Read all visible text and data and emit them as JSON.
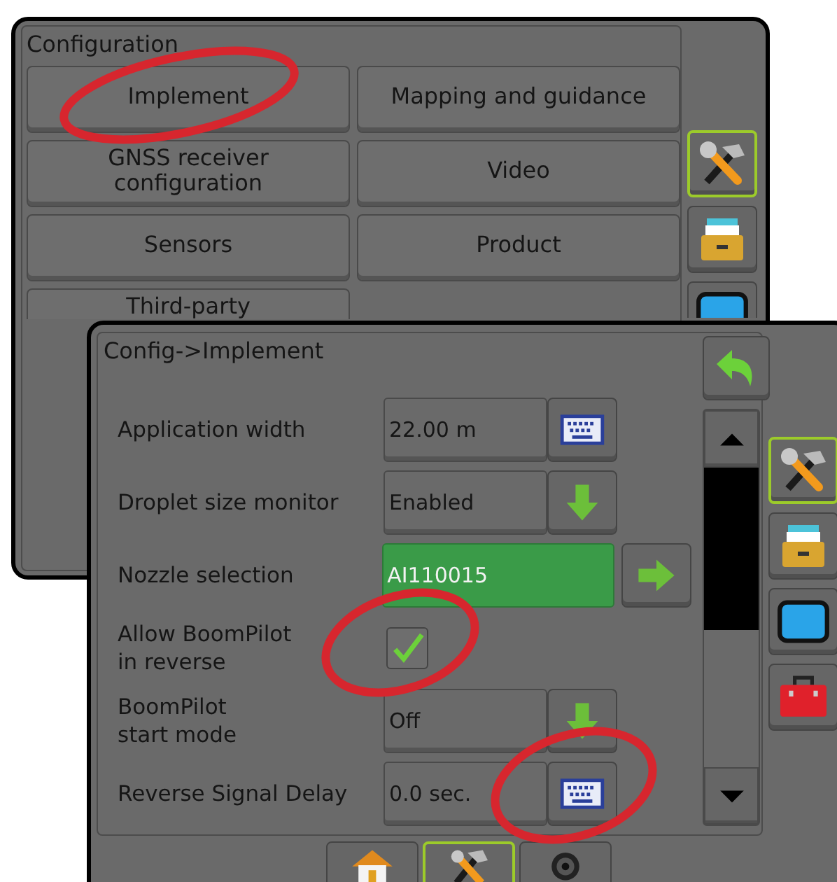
{
  "back_window": {
    "title": "Configuration",
    "buttons": [
      {
        "label": "Implement"
      },
      {
        "label": "Mapping and guidance"
      },
      {
        "label": "GNSS receiver\nconfiguration"
      },
      {
        "label": "Video"
      },
      {
        "label": "Sensors"
      },
      {
        "label": "Product"
      },
      {
        "label": "Third-party"
      }
    ],
    "side_tabs": [
      {
        "kind": "tools",
        "selected": true
      },
      {
        "kind": "storage",
        "selected": false
      },
      {
        "kind": "display",
        "selected": false
      }
    ]
  },
  "front_window": {
    "title": "Config->Implement",
    "settings": [
      {
        "kind": "keyboard",
        "label": "Application width",
        "value": "22.00 m"
      },
      {
        "kind": "dropdown",
        "label": "Droplet size monitor",
        "value": "Enabled"
      },
      {
        "kind": "select",
        "label": "Nozzle selection",
        "value": "AI110015"
      },
      {
        "kind": "checkbox",
        "label": "Allow BoomPilot\nin reverse",
        "checked": true
      },
      {
        "kind": "dropdown",
        "label": "BoomPilot\nstart mode",
        "value": "Off"
      },
      {
        "kind": "keyboard",
        "label": "Reverse Signal Delay",
        "value": "0.0 sec."
      }
    ],
    "side_tabs": [
      {
        "kind": "tools",
        "selected": true
      },
      {
        "kind": "storage",
        "selected": false
      },
      {
        "kind": "display",
        "selected": false
      },
      {
        "kind": "toolbox",
        "selected": false
      }
    ],
    "bottom_tabs": [
      {
        "kind": "home",
        "selected": false
      },
      {
        "kind": "tools",
        "selected": true
      },
      {
        "kind": "camera",
        "selected": false
      }
    ]
  }
}
